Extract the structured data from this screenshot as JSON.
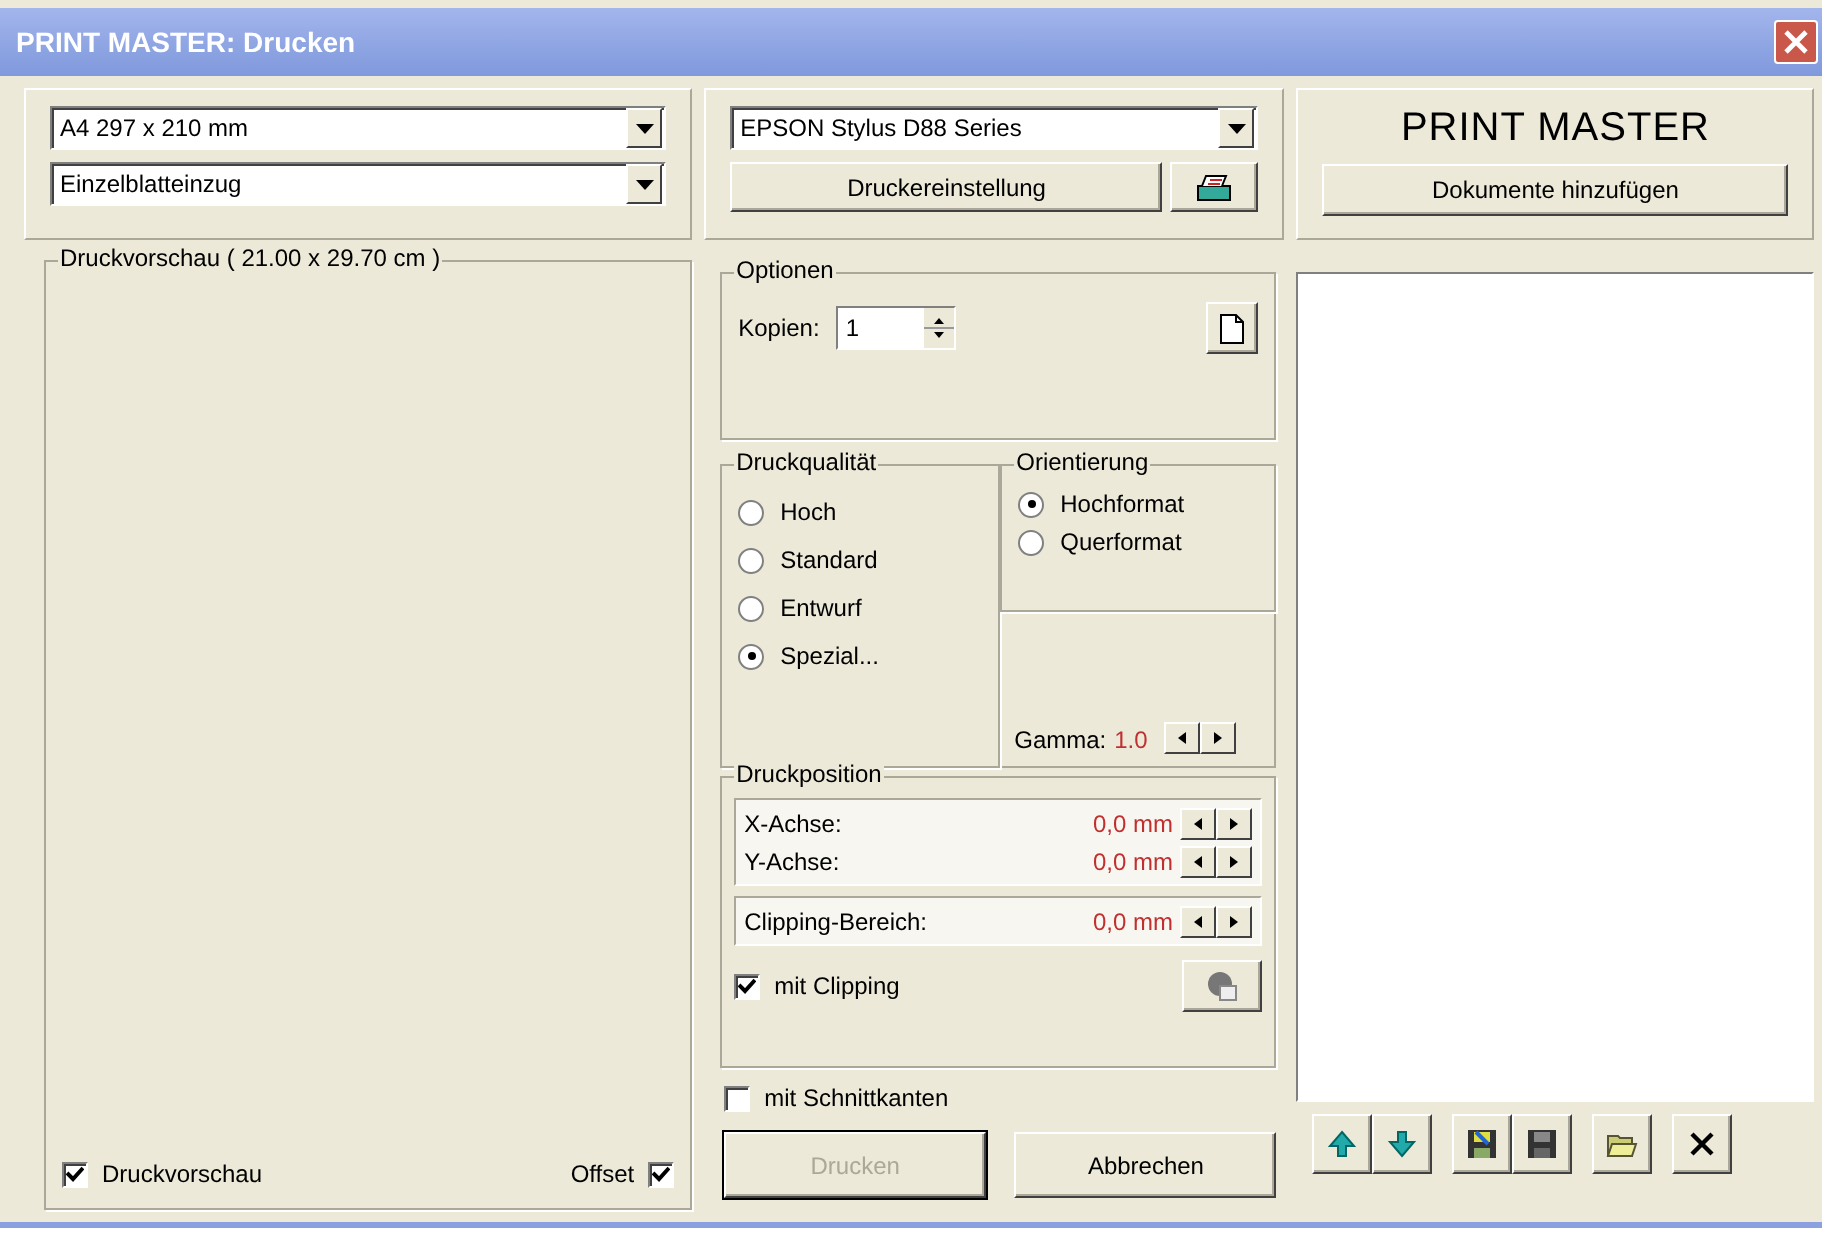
{
  "window": {
    "title": "PRINT MASTER: Drucken"
  },
  "paper": {
    "size": "A4 297 x 210 mm",
    "source": "Einzelblatteinzug"
  },
  "preview": {
    "title": "Druckvorschau ( 21.00 x 29.70 cm )",
    "show": {
      "label": "Druckvorschau",
      "checked": true
    },
    "offset": {
      "label": "Offset",
      "checked": true
    }
  },
  "printer": {
    "name": "EPSON Stylus D88 Series",
    "settings_button": "Druckereinstellung"
  },
  "options": {
    "title": "Optionen",
    "copies_label": "Kopien:",
    "copies": "1"
  },
  "quality": {
    "title": "Druckqualität",
    "options": [
      {
        "label": "Hoch",
        "selected": false
      },
      {
        "label": "Standard",
        "selected": false
      },
      {
        "label": "Entwurf",
        "selected": false
      },
      {
        "label": "Spezial...",
        "selected": true
      }
    ]
  },
  "orientation": {
    "title": "Orientierung",
    "options": [
      {
        "label": "Hochformat",
        "selected": true
      },
      {
        "label": "Querformat",
        "selected": false
      }
    ]
  },
  "gamma": {
    "label": "Gamma:",
    "value": "1.0"
  },
  "position": {
    "title": "Druckposition",
    "axes": [
      {
        "label": "X-Achse:",
        "value": "0,0 mm"
      },
      {
        "label": "Y-Achse:",
        "value": "0,0 mm"
      }
    ],
    "clipping": {
      "label": "Clipping-Bereich:",
      "value": "0,0 mm"
    },
    "clip_check": {
      "label": "mit Clipping",
      "checked": true
    }
  },
  "cut_edges": {
    "label": "mit Schnittkanten",
    "checked": false
  },
  "buttons": [
    {
      "label": "Drucken",
      "disabled": true
    },
    {
      "label": "Abbrechen",
      "disabled": false
    }
  ],
  "app": {
    "title": "PRINT MASTER",
    "add_button": "Dokumente hinzufügen"
  }
}
